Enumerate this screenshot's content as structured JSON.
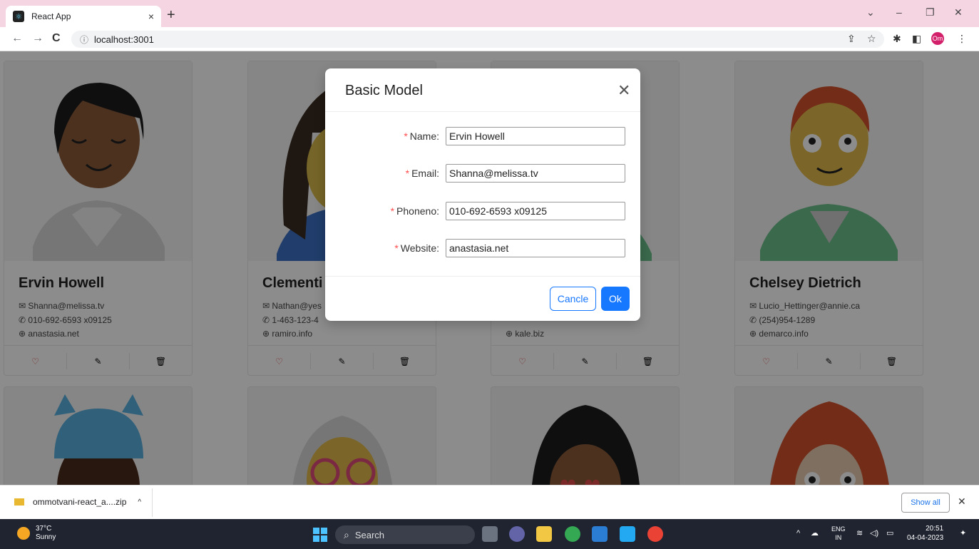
{
  "browser": {
    "tab_title": "React App",
    "tab_close": "×",
    "new_tab": "+",
    "url": "localhost:3001",
    "profile_initials": "Om",
    "window_controls": {
      "dropdown": "⌄",
      "minimize": "–",
      "restore": "❐",
      "close": "✕"
    }
  },
  "cards": [
    {
      "name": "Ervin Howell",
      "email": "Shanna@melissa.tv",
      "phone": "010-692-6593 x09125",
      "website": "anastasia.net"
    },
    {
      "name": "Clementi",
      "email": "Nathan@yes",
      "phone": "1-463-123-4",
      "website": "ramiro.info"
    },
    {
      "name": "",
      "email": "",
      "phone": "",
      "website": "kale.biz"
    },
    {
      "name": "Chelsey Dietrich",
      "email": "Lucio_Hettinger@annie.ca",
      "phone": "(254)954-1289",
      "website": "demarco.info"
    }
  ],
  "modal": {
    "title": "Basic Model",
    "close": "✕",
    "fields": [
      {
        "label": "Name:",
        "value": "Ervin Howell"
      },
      {
        "label": "Email:",
        "value": "Shanna@melissa.tv"
      },
      {
        "label": "Phoneno:",
        "value": "010-692-6593 x09125"
      },
      {
        "label": "Website:",
        "value": "anastasia.net"
      }
    ],
    "required_mark": "*",
    "cancel_label": "Cancle",
    "ok_label": "Ok"
  },
  "download": {
    "filename": "ommotvani-react_a....zip",
    "show_all": "Show all",
    "close": "✕"
  },
  "taskbar": {
    "temperature": "37°C",
    "weather": "Sunny",
    "search": "Search",
    "lang": "ENG",
    "region": "IN",
    "time": "20:51",
    "date": "04-04-2023"
  },
  "colors": {
    "primary": "#1677ff",
    "heart": "#e03030",
    "required": "#ff4d4f"
  }
}
